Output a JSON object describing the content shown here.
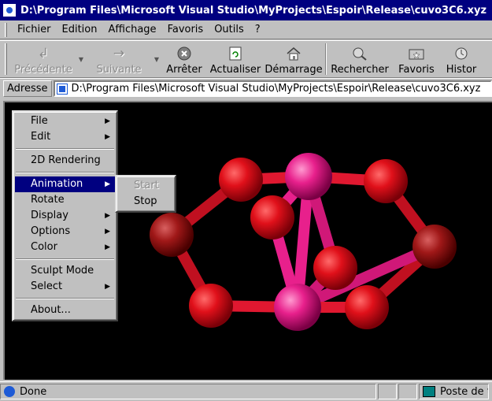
{
  "window": {
    "title": "D:\\Program Files\\Microsoft Visual Studio\\MyProjects\\Espoir\\Release\\cuvo3C6.xyz"
  },
  "menubar": {
    "items": [
      {
        "label": "Fichier"
      },
      {
        "label": "Edition"
      },
      {
        "label": "Affichage"
      },
      {
        "label": "Favoris"
      },
      {
        "label": "Outils"
      },
      {
        "label": "?"
      }
    ]
  },
  "toolbar": {
    "back_label": "Précédente",
    "forward_label": "Suivante",
    "stop_label": "Arrêter",
    "refresh_label": "Actualiser",
    "home_label": "Démarrage",
    "search_label": "Rechercher",
    "favorites_label": "Favoris",
    "history_label": "Histor"
  },
  "address": {
    "label": "Adresse",
    "value": "D:\\Program Files\\Microsoft Visual Studio\\MyProjects\\Espoir\\Release\\cuvo3C6.xyz"
  },
  "context_menu": {
    "file": "File",
    "edit": "Edit",
    "rendering_2d": "2D Rendering",
    "animation": "Animation",
    "rotate": "Rotate",
    "display": "Display",
    "options": "Options",
    "color": "Color",
    "sculpt_mode": "Sculpt Mode",
    "select": "Select",
    "about": "About..."
  },
  "submenu": {
    "start": "Start",
    "stop": "Stop"
  },
  "status": {
    "text": "Done",
    "zone": "Poste de t"
  },
  "colors": {
    "atom_red": "#e0101a",
    "atom_pink": "#e8208c",
    "atom_dark": "#a01818",
    "menu_highlight": "#000080"
  }
}
